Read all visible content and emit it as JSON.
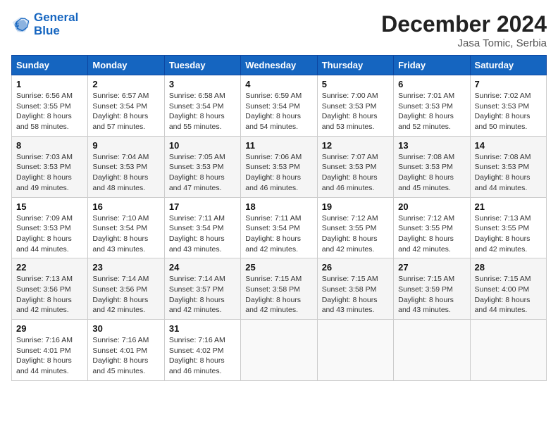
{
  "header": {
    "logo_line1": "General",
    "logo_line2": "Blue",
    "month": "December 2024",
    "location": "Jasa Tomic, Serbia"
  },
  "days_of_week": [
    "Sunday",
    "Monday",
    "Tuesday",
    "Wednesday",
    "Thursday",
    "Friday",
    "Saturday"
  ],
  "weeks": [
    [
      {
        "num": "1",
        "sr": "6:56 AM",
        "ss": "3:55 PM",
        "dl": "8 hours and 58 minutes."
      },
      {
        "num": "2",
        "sr": "6:57 AM",
        "ss": "3:54 PM",
        "dl": "8 hours and 57 minutes."
      },
      {
        "num": "3",
        "sr": "6:58 AM",
        "ss": "3:54 PM",
        "dl": "8 hours and 55 minutes."
      },
      {
        "num": "4",
        "sr": "6:59 AM",
        "ss": "3:54 PM",
        "dl": "8 hours and 54 minutes."
      },
      {
        "num": "5",
        "sr": "7:00 AM",
        "ss": "3:53 PM",
        "dl": "8 hours and 53 minutes."
      },
      {
        "num": "6",
        "sr": "7:01 AM",
        "ss": "3:53 PM",
        "dl": "8 hours and 52 minutes."
      },
      {
        "num": "7",
        "sr": "7:02 AM",
        "ss": "3:53 PM",
        "dl": "8 hours and 50 minutes."
      }
    ],
    [
      {
        "num": "8",
        "sr": "7:03 AM",
        "ss": "3:53 PM",
        "dl": "8 hours and 49 minutes."
      },
      {
        "num": "9",
        "sr": "7:04 AM",
        "ss": "3:53 PM",
        "dl": "8 hours and 48 minutes."
      },
      {
        "num": "10",
        "sr": "7:05 AM",
        "ss": "3:53 PM",
        "dl": "8 hours and 47 minutes."
      },
      {
        "num": "11",
        "sr": "7:06 AM",
        "ss": "3:53 PM",
        "dl": "8 hours and 46 minutes."
      },
      {
        "num": "12",
        "sr": "7:07 AM",
        "ss": "3:53 PM",
        "dl": "8 hours and 46 minutes."
      },
      {
        "num": "13",
        "sr": "7:08 AM",
        "ss": "3:53 PM",
        "dl": "8 hours and 45 minutes."
      },
      {
        "num": "14",
        "sr": "7:08 AM",
        "ss": "3:53 PM",
        "dl": "8 hours and 44 minutes."
      }
    ],
    [
      {
        "num": "15",
        "sr": "7:09 AM",
        "ss": "3:53 PM",
        "dl": "8 hours and 44 minutes."
      },
      {
        "num": "16",
        "sr": "7:10 AM",
        "ss": "3:54 PM",
        "dl": "8 hours and 43 minutes."
      },
      {
        "num": "17",
        "sr": "7:11 AM",
        "ss": "3:54 PM",
        "dl": "8 hours and 43 minutes."
      },
      {
        "num": "18",
        "sr": "7:11 AM",
        "ss": "3:54 PM",
        "dl": "8 hours and 42 minutes."
      },
      {
        "num": "19",
        "sr": "7:12 AM",
        "ss": "3:55 PM",
        "dl": "8 hours and 42 minutes."
      },
      {
        "num": "20",
        "sr": "7:12 AM",
        "ss": "3:55 PM",
        "dl": "8 hours and 42 minutes."
      },
      {
        "num": "21",
        "sr": "7:13 AM",
        "ss": "3:55 PM",
        "dl": "8 hours and 42 minutes."
      }
    ],
    [
      {
        "num": "22",
        "sr": "7:13 AM",
        "ss": "3:56 PM",
        "dl": "8 hours and 42 minutes."
      },
      {
        "num": "23",
        "sr": "7:14 AM",
        "ss": "3:56 PM",
        "dl": "8 hours and 42 minutes."
      },
      {
        "num": "24",
        "sr": "7:14 AM",
        "ss": "3:57 PM",
        "dl": "8 hours and 42 minutes."
      },
      {
        "num": "25",
        "sr": "7:15 AM",
        "ss": "3:58 PM",
        "dl": "8 hours and 42 minutes."
      },
      {
        "num": "26",
        "sr": "7:15 AM",
        "ss": "3:58 PM",
        "dl": "8 hours and 43 minutes."
      },
      {
        "num": "27",
        "sr": "7:15 AM",
        "ss": "3:59 PM",
        "dl": "8 hours and 43 minutes."
      },
      {
        "num": "28",
        "sr": "7:15 AM",
        "ss": "4:00 PM",
        "dl": "8 hours and 44 minutes."
      }
    ],
    [
      {
        "num": "29",
        "sr": "7:16 AM",
        "ss": "4:01 PM",
        "dl": "8 hours and 44 minutes."
      },
      {
        "num": "30",
        "sr": "7:16 AM",
        "ss": "4:01 PM",
        "dl": "8 hours and 45 minutes."
      },
      {
        "num": "31",
        "sr": "7:16 AM",
        "ss": "4:02 PM",
        "dl": "8 hours and 46 minutes."
      },
      null,
      null,
      null,
      null
    ]
  ],
  "labels": {
    "sunrise": "Sunrise:",
    "sunset": "Sunset:",
    "daylight": "Daylight:"
  }
}
